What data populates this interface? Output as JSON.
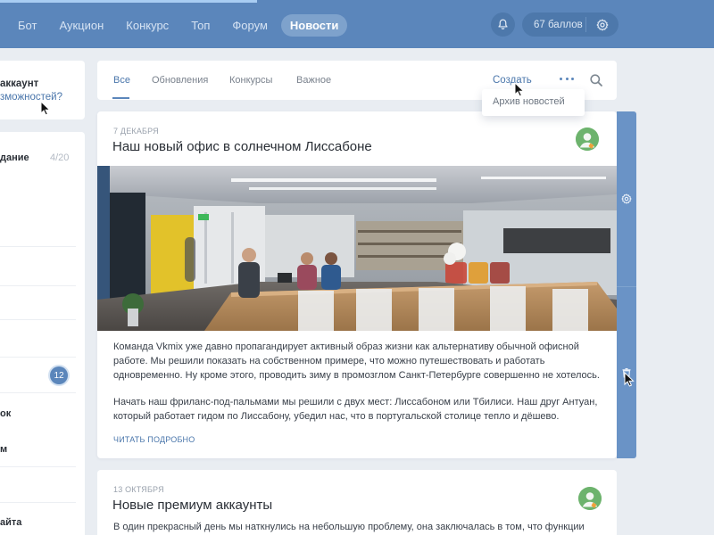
{
  "nav": {
    "items": [
      {
        "label": "Бот"
      },
      {
        "label": "Аукцион"
      },
      {
        "label": "Конкурс"
      },
      {
        "label": "Топ"
      },
      {
        "label": "Форум"
      },
      {
        "label": "Новости",
        "active": true
      }
    ],
    "points_label": "67 баллов",
    "bell_icon": "bell-icon",
    "settings_icon": "gear-icon"
  },
  "sidebar": {
    "account_title": "аккаунт",
    "account_link": "зможностей?",
    "task_label": "дание",
    "task_count": "4/20",
    "badge": "12",
    "row_1": "ок",
    "row_2": "м",
    "row_3": "айта"
  },
  "tabs": {
    "items": [
      {
        "label": "Все",
        "active": true
      },
      {
        "label": "Обновления"
      },
      {
        "label": "Конкурсы"
      },
      {
        "label": "Важное"
      }
    ],
    "create_label": "Создать",
    "search_icon": "search-icon",
    "more_icon": "more-dots-icon"
  },
  "dropdown": {
    "archive_label": "Архив новостей"
  },
  "news": [
    {
      "date": "7 ДЕКАБРЯ",
      "title": "Наш новый офис в солнечном Лиссабоне",
      "paragraph_1": "Команда Vkmix уже давно пропагандирует активный образ жизни как альтернативу обычной офисной работе. Мы решили показать на собственном примере, что можно путешествовать и работать одновременно. Ну кроме этого, проводить зиму в промозглом Санкт-Петербурге совершенно не хотелось.",
      "paragraph_2": "Начать наш фриланс-под-пальмами мы решили с двух мест:  Лиссабоном или Тбилиси. Наш друг Антуан, который работает гидом по Лиссабону, убедил нас, что в португальской столице тепло и дёшево.",
      "read_more": "ЧИТАТЬ ПОДРОБНО"
    },
    {
      "date": "13 ОКТЯБРЯ",
      "title": "Новые премиум аккаунты",
      "paragraph_1": "В один прекрасный день мы наткнулись на небольшую проблему, она заключалась в том, что функции"
    }
  ],
  "strip": {
    "settings_icon": "gear-icon",
    "delete_icon": "trash-icon"
  },
  "colors": {
    "topbar": "#5b86bb",
    "accent": "#4a76ab",
    "background": "#e9edf2",
    "strip": "#6a93c6"
  }
}
